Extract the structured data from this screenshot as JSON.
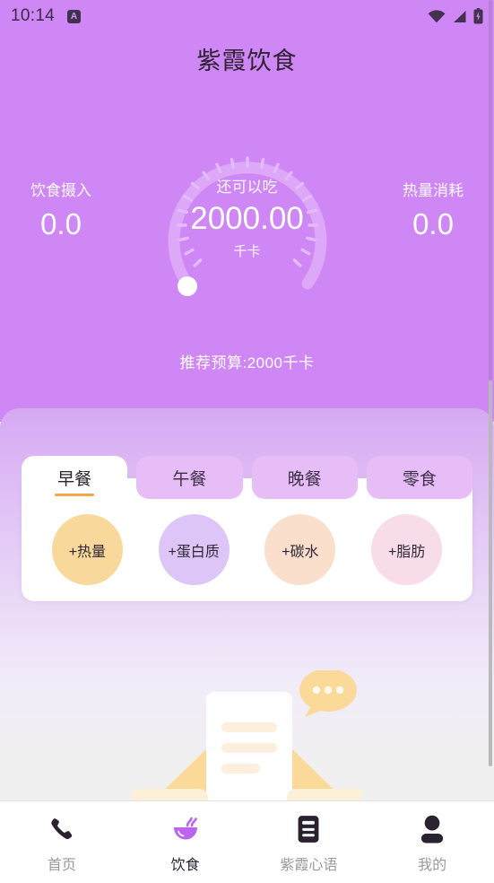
{
  "status_bar": {
    "time": "10:14",
    "app_badge_icon": "app-badge-icon",
    "wifi_icon": "wifi-icon",
    "signal_icon": "signal-icon",
    "battery_icon": "battery-charging-icon"
  },
  "header": {
    "title": "紫霞饮食"
  },
  "gauge": {
    "label": "还可以吃",
    "value": "2000.00",
    "unit": "千卡",
    "progress_percent": 0,
    "track_color": "#dda9f7",
    "tick_color": "#e7c3fa",
    "knob_color": "#ffffff"
  },
  "stats": {
    "left": {
      "label": "饮食摄入",
      "value": "0.0"
    },
    "right": {
      "label": "热量消耗",
      "value": "0.0"
    }
  },
  "budget": {
    "text": "推荐预算:2000千卡"
  },
  "meal_tabs": [
    {
      "label": "早餐",
      "active": true
    },
    {
      "label": "午餐",
      "active": false
    },
    {
      "label": "晚餐",
      "active": false
    },
    {
      "label": "零食",
      "active": false
    }
  ],
  "macro_buttons": [
    {
      "label": "+热量",
      "color": "#f8d99b"
    },
    {
      "label": "+蛋白质",
      "color": "#ddc6f7"
    },
    {
      "label": "+碳水",
      "color": "#fadfcd"
    },
    {
      "label": "+脂肪",
      "color": "#f9dcea"
    }
  ],
  "empty_state": {
    "illustration_icon": "empty-inbox-illustration",
    "bubble_icon": "chat-bubble-icon"
  },
  "bottom_nav": [
    {
      "label": "首页",
      "icon": "phone-icon",
      "active": false
    },
    {
      "label": "饮食",
      "icon": "bowl-icon",
      "active": true
    },
    {
      "label": "紫霞心语",
      "icon": "document-icon",
      "active": false
    },
    {
      "label": "我的",
      "icon": "person-icon",
      "active": false
    }
  ],
  "theme": {
    "primary_purple": "#ce87f5",
    "accent_orange": "#f0a949",
    "tab_inactive": "#e7bdf8",
    "sheet_bottom": "#f0f0f0"
  }
}
